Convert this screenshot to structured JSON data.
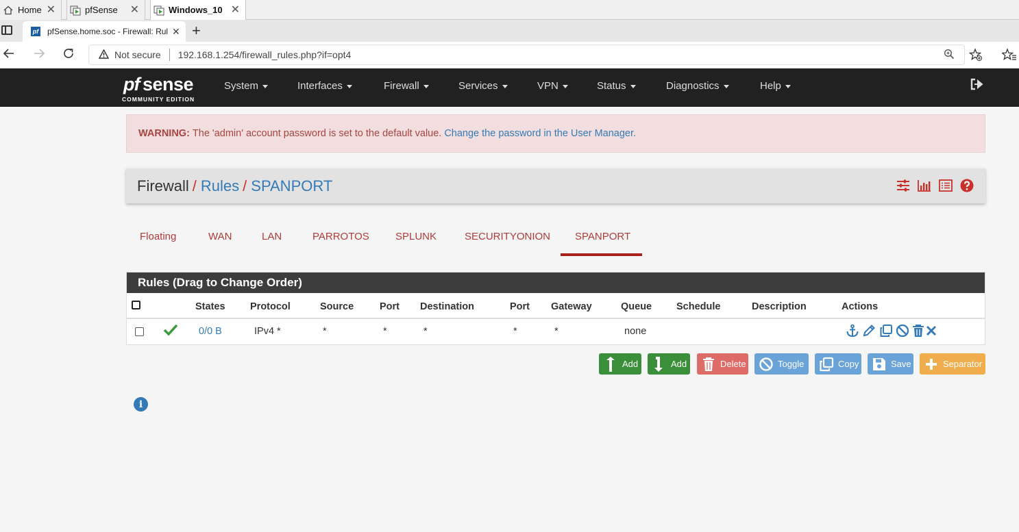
{
  "vm_tabs": [
    {
      "label": "Home"
    },
    {
      "label": "pfSense"
    },
    {
      "label": "Windows_10"
    }
  ],
  "browser": {
    "tab_title": "pfSense.home.soc - Firewall: Rules",
    "favicon_text": "pf",
    "not_secure": "Not secure",
    "url": "192.168.1.254/firewall_rules.php?if=opt4"
  },
  "logo": {
    "pf": "pf",
    "sense": "sense",
    "edition": "COMMUNITY EDITION"
  },
  "menu": [
    "System",
    "Interfaces",
    "Firewall",
    "Services",
    "VPN",
    "Status",
    "Diagnostics",
    "Help"
  ],
  "alert": {
    "label": "WARNING:",
    "text": "The 'admin' account password is set to the default value.",
    "link": "Change the password in the User Manager."
  },
  "breadcrumb": {
    "root": "Firewall",
    "sep": "/",
    "rules": "Rules",
    "current": "SPANPORT"
  },
  "subtabs": [
    "Floating",
    "WAN",
    "LAN",
    "PARROTOS",
    "SPLUNK",
    "SECURITYONION",
    "SPANPORT"
  ],
  "active_subtab": "SPANPORT",
  "rules": {
    "title": "Rules (Drag to Change Order)",
    "columns": [
      "States",
      "Protocol",
      "Source",
      "Port",
      "Destination",
      "Port",
      "Gateway",
      "Queue",
      "Schedule",
      "Description",
      "Actions"
    ],
    "rows": [
      {
        "states": "0/0 B",
        "protocol": "IPv4 *",
        "source": "*",
        "port": "*",
        "destination": "*",
        "dest_port": "*",
        "gateway": "*",
        "queue": "none",
        "schedule": "",
        "description": ""
      }
    ]
  },
  "buttons": {
    "add_top": "Add",
    "add_bottom": "Add",
    "delete": "Delete",
    "toggle": "Toggle",
    "copy": "Copy",
    "save": "Save",
    "separator": "Separator"
  },
  "colors": {
    "navbar": "#212121",
    "accent_red": "#c9302c",
    "link_blue": "#337ab7",
    "success_green": "#3b8f3b",
    "warning_orange": "#f0ad4e"
  }
}
